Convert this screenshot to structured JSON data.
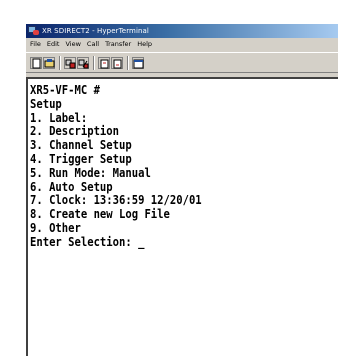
{
  "window": {
    "title": "XR SDIRECT2 - HyperTerminal"
  },
  "menu": [
    "File",
    "Edit",
    "View",
    "Call",
    "Transfer",
    "Help"
  ],
  "toolbar": {
    "buttons": [
      {
        "icon": "new-icon"
      },
      {
        "icon": "open-icon"
      },
      {
        "icon": "connect-icon"
      },
      {
        "icon": "disconnect-icon"
      },
      {
        "icon": "send-icon"
      },
      {
        "icon": "receive-icon"
      },
      {
        "icon": "properties-icon"
      }
    ]
  },
  "terminal": {
    "lines": [
      "XR5-VF-MC #",
      "Setup",
      "1. Label:",
      "2. Description",
      "3. Channel Setup",
      "4. Trigger Setup",
      "5. Run Mode: Manual",
      "6. Auto Setup",
      "7. Clock: 13:36:59 12/20/01",
      "8. Create new Log File",
      "9. Other",
      "Enter Selection: "
    ],
    "cursor": "_"
  }
}
